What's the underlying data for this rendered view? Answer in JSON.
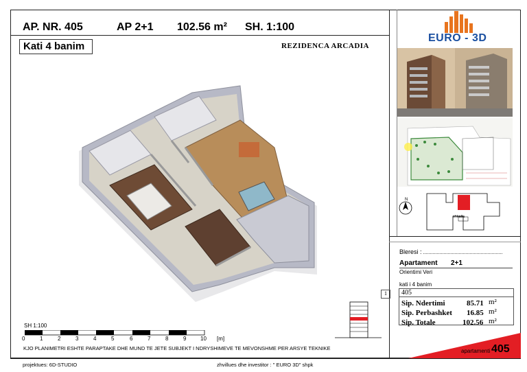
{
  "header": {
    "apt_number": "AP. NR. 405",
    "apt_type": "AP 2+1",
    "area": "102.56 m²",
    "scale": "SH. 1:100",
    "floor": "Kati 4 banim",
    "project_name": "REZIDENCA ARCADIA"
  },
  "brand": {
    "logo_text": "EURO - 3D",
    "colors": {
      "logo_orange": "#e8741e",
      "logo_blue": "#1a4fa0",
      "accent_red": "#e31e24"
    }
  },
  "siteplan": {
    "north_label": "N",
    "position_label": "shkalla"
  },
  "details": {
    "buyer_label": "Bleresi :",
    "apartment_label": "Apartament",
    "apartment_type": "2+1",
    "orientation": "Orientimi  Veri",
    "floor": "kati i 4 banim",
    "number": "405",
    "rows": [
      {
        "label": "Sip. Ndertimi",
        "value": "85.71",
        "unit": "m²"
      },
      {
        "label": "Sip. Perbashket",
        "value": "16.85",
        "unit": "m²"
      },
      {
        "label": "Sip. Totale",
        "value": "102.56",
        "unit": "m²"
      }
    ],
    "tab_number": "1"
  },
  "footer": {
    "badge_label": "apartamenti",
    "badge_number": "405",
    "scale_title": "SH 1:100",
    "scale_ticks": [
      "0",
      "1",
      "2",
      "3",
      "4",
      "5",
      "6",
      "7",
      "8",
      "9",
      "10",
      "[m]"
    ],
    "disclaimer": "KJO PLANIMETRI ESHTE PARAPTAKE DHE MUND TE JETE SUBJEKT I NDRYSHIMEVE TE MEVONSHME PER ARSYE TEKNIKE",
    "designer": "projektues:  6D-STUDIO",
    "developer": "zhvillues dhe investitor :  \" EURO 3D\" shpk"
  }
}
